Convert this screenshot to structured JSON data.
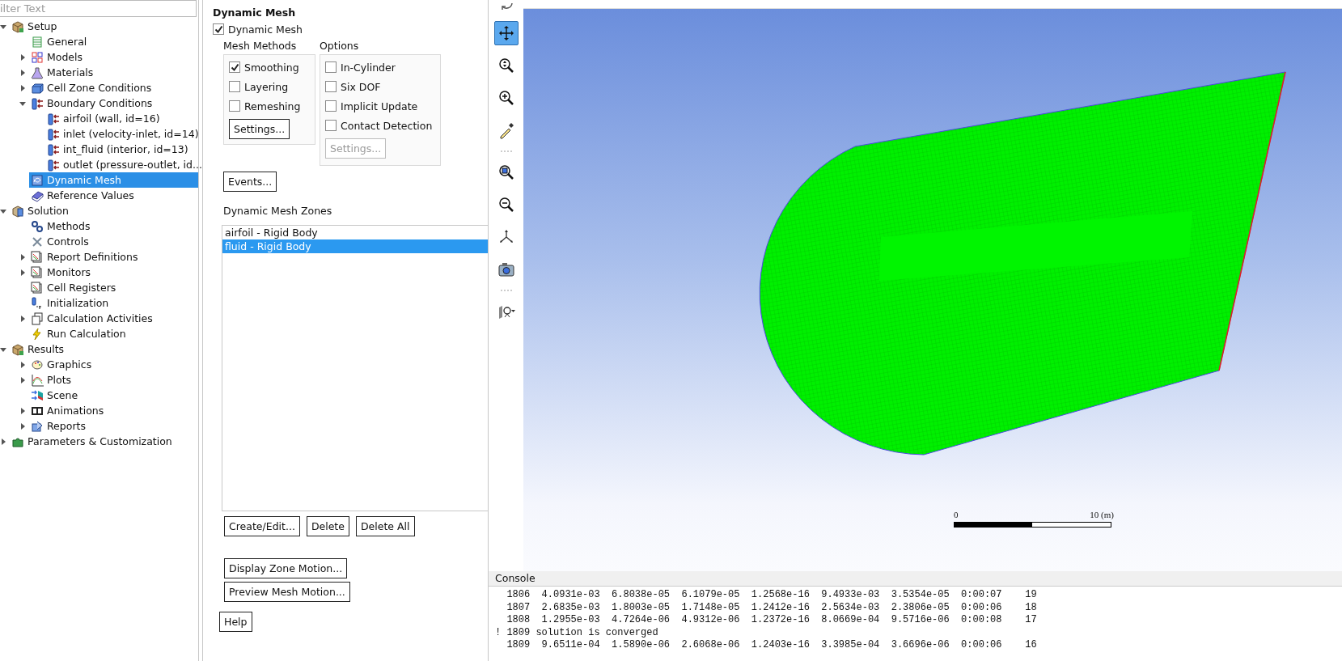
{
  "tree": {
    "filter": {
      "placeholder": "ilter Text"
    },
    "items": [
      {
        "label": "Setup",
        "expanded": true,
        "selected": false,
        "children": [
          {
            "label": "General",
            "selected": false
          },
          {
            "label": "Models",
            "expanded": false,
            "selected": false
          },
          {
            "label": "Materials",
            "expanded": false,
            "selected": false
          },
          {
            "label": "Cell Zone Conditions",
            "expanded": false,
            "selected": false
          },
          {
            "label": "Boundary Conditions",
            "expanded": true,
            "selected": false,
            "children": [
              {
                "label": "airfoil (wall, id=16)",
                "selected": false
              },
              {
                "label": "inlet (velocity-inlet, id=14)",
                "selected": false
              },
              {
                "label": "int_fluid (interior, id=13)",
                "selected": false
              },
              {
                "label": "outlet (pressure-outlet, id...",
                "selected": false
              }
            ]
          },
          {
            "label": "Dynamic Mesh",
            "selected": true
          },
          {
            "label": "Reference Values",
            "selected": false
          }
        ]
      },
      {
        "label": "Solution",
        "expanded": true,
        "selected": false,
        "children": [
          {
            "label": "Methods",
            "selected": false
          },
          {
            "label": "Controls",
            "selected": false
          },
          {
            "label": "Report Definitions",
            "expanded": false,
            "selected": false
          },
          {
            "label": "Monitors",
            "expanded": false,
            "selected": false
          },
          {
            "label": "Cell Registers",
            "selected": false
          },
          {
            "label": "Initialization",
            "selected": false
          },
          {
            "label": "Calculation Activities",
            "expanded": false,
            "selected": false
          },
          {
            "label": "Run Calculation",
            "selected": false
          }
        ]
      },
      {
        "label": "Results",
        "expanded": true,
        "selected": false,
        "children": [
          {
            "label": "Graphics",
            "expanded": false,
            "selected": false
          },
          {
            "label": "Plots",
            "expanded": false,
            "selected": false
          },
          {
            "label": "Scene",
            "selected": false
          },
          {
            "label": "Animations",
            "expanded": false,
            "selected": false
          },
          {
            "label": "Reports",
            "expanded": false,
            "selected": false
          }
        ]
      },
      {
        "label": "Parameters & Customization",
        "expanded": false,
        "selected": false
      }
    ]
  },
  "panel": {
    "title": "Dynamic Mesh",
    "dynamic_mesh": {
      "label": "Dynamic Mesh",
      "checked": true
    },
    "mesh_methods": {
      "title": "Mesh Methods",
      "options": [
        {
          "label": "Smoothing",
          "checked": true
        },
        {
          "label": "Layering",
          "checked": false
        },
        {
          "label": "Remeshing",
          "checked": false
        }
      ],
      "button": {
        "label": "Settings...",
        "disabled": false
      }
    },
    "options": {
      "title": "Options",
      "options": [
        {
          "label": "In-Cylinder",
          "checked": false
        },
        {
          "label": "Six DOF",
          "checked": false
        },
        {
          "label": "Implicit Update",
          "checked": false
        },
        {
          "label": "Contact Detection",
          "checked": false
        }
      ],
      "button": {
        "label": "Settings...",
        "disabled": true
      }
    },
    "events_button": "Events...",
    "zones": {
      "title": "Dynamic Mesh Zones",
      "items": [
        {
          "label": "airfoil - Rigid Body",
          "selected": false
        },
        {
          "label": "fluid - Rigid Body",
          "selected": true
        }
      ]
    },
    "zone_buttons": [
      "Create/Edit...",
      "Delete",
      "Delete All"
    ],
    "motion_buttons": [
      "Display Zone Motion...",
      "Preview Mesh Motion..."
    ],
    "help_button": "Help"
  },
  "toolbar": [
    {
      "selected": false
    },
    {
      "selected": true
    },
    {
      "selected": false
    },
    {
      "selected": false
    },
    {
      "selected": false
    },
    {
      "selected": false
    },
    {
      "selected": false
    },
    {
      "selected": false
    },
    {
      "selected": false
    },
    {
      "selected": false
    }
  ],
  "viewport": {
    "scale": {
      "start": "0",
      "end": "10 (m)"
    }
  },
  "console": {
    "title": "Console",
    "lines": [
      "  1806  4.0931e-03  6.8038e-05  6.1079e-05  1.2568e-16  9.4933e-03  3.5354e-05  0:00:07    19",
      "  1807  2.6835e-03  1.8003e-05  1.7148e-05  1.2412e-16  2.5634e-03  2.3806e-05  0:00:06    18",
      "  1808  1.2955e-03  4.7264e-06  4.9312e-06  1.2372e-16  8.0669e-04  9.5716e-06  0:00:08    17",
      "! 1809 solution is converged",
      "  1809  9.6511e-04  1.5890e-06  2.6068e-06  1.2403e-16  3.3985e-04  3.6696e-06  0:00:06    16"
    ]
  }
}
